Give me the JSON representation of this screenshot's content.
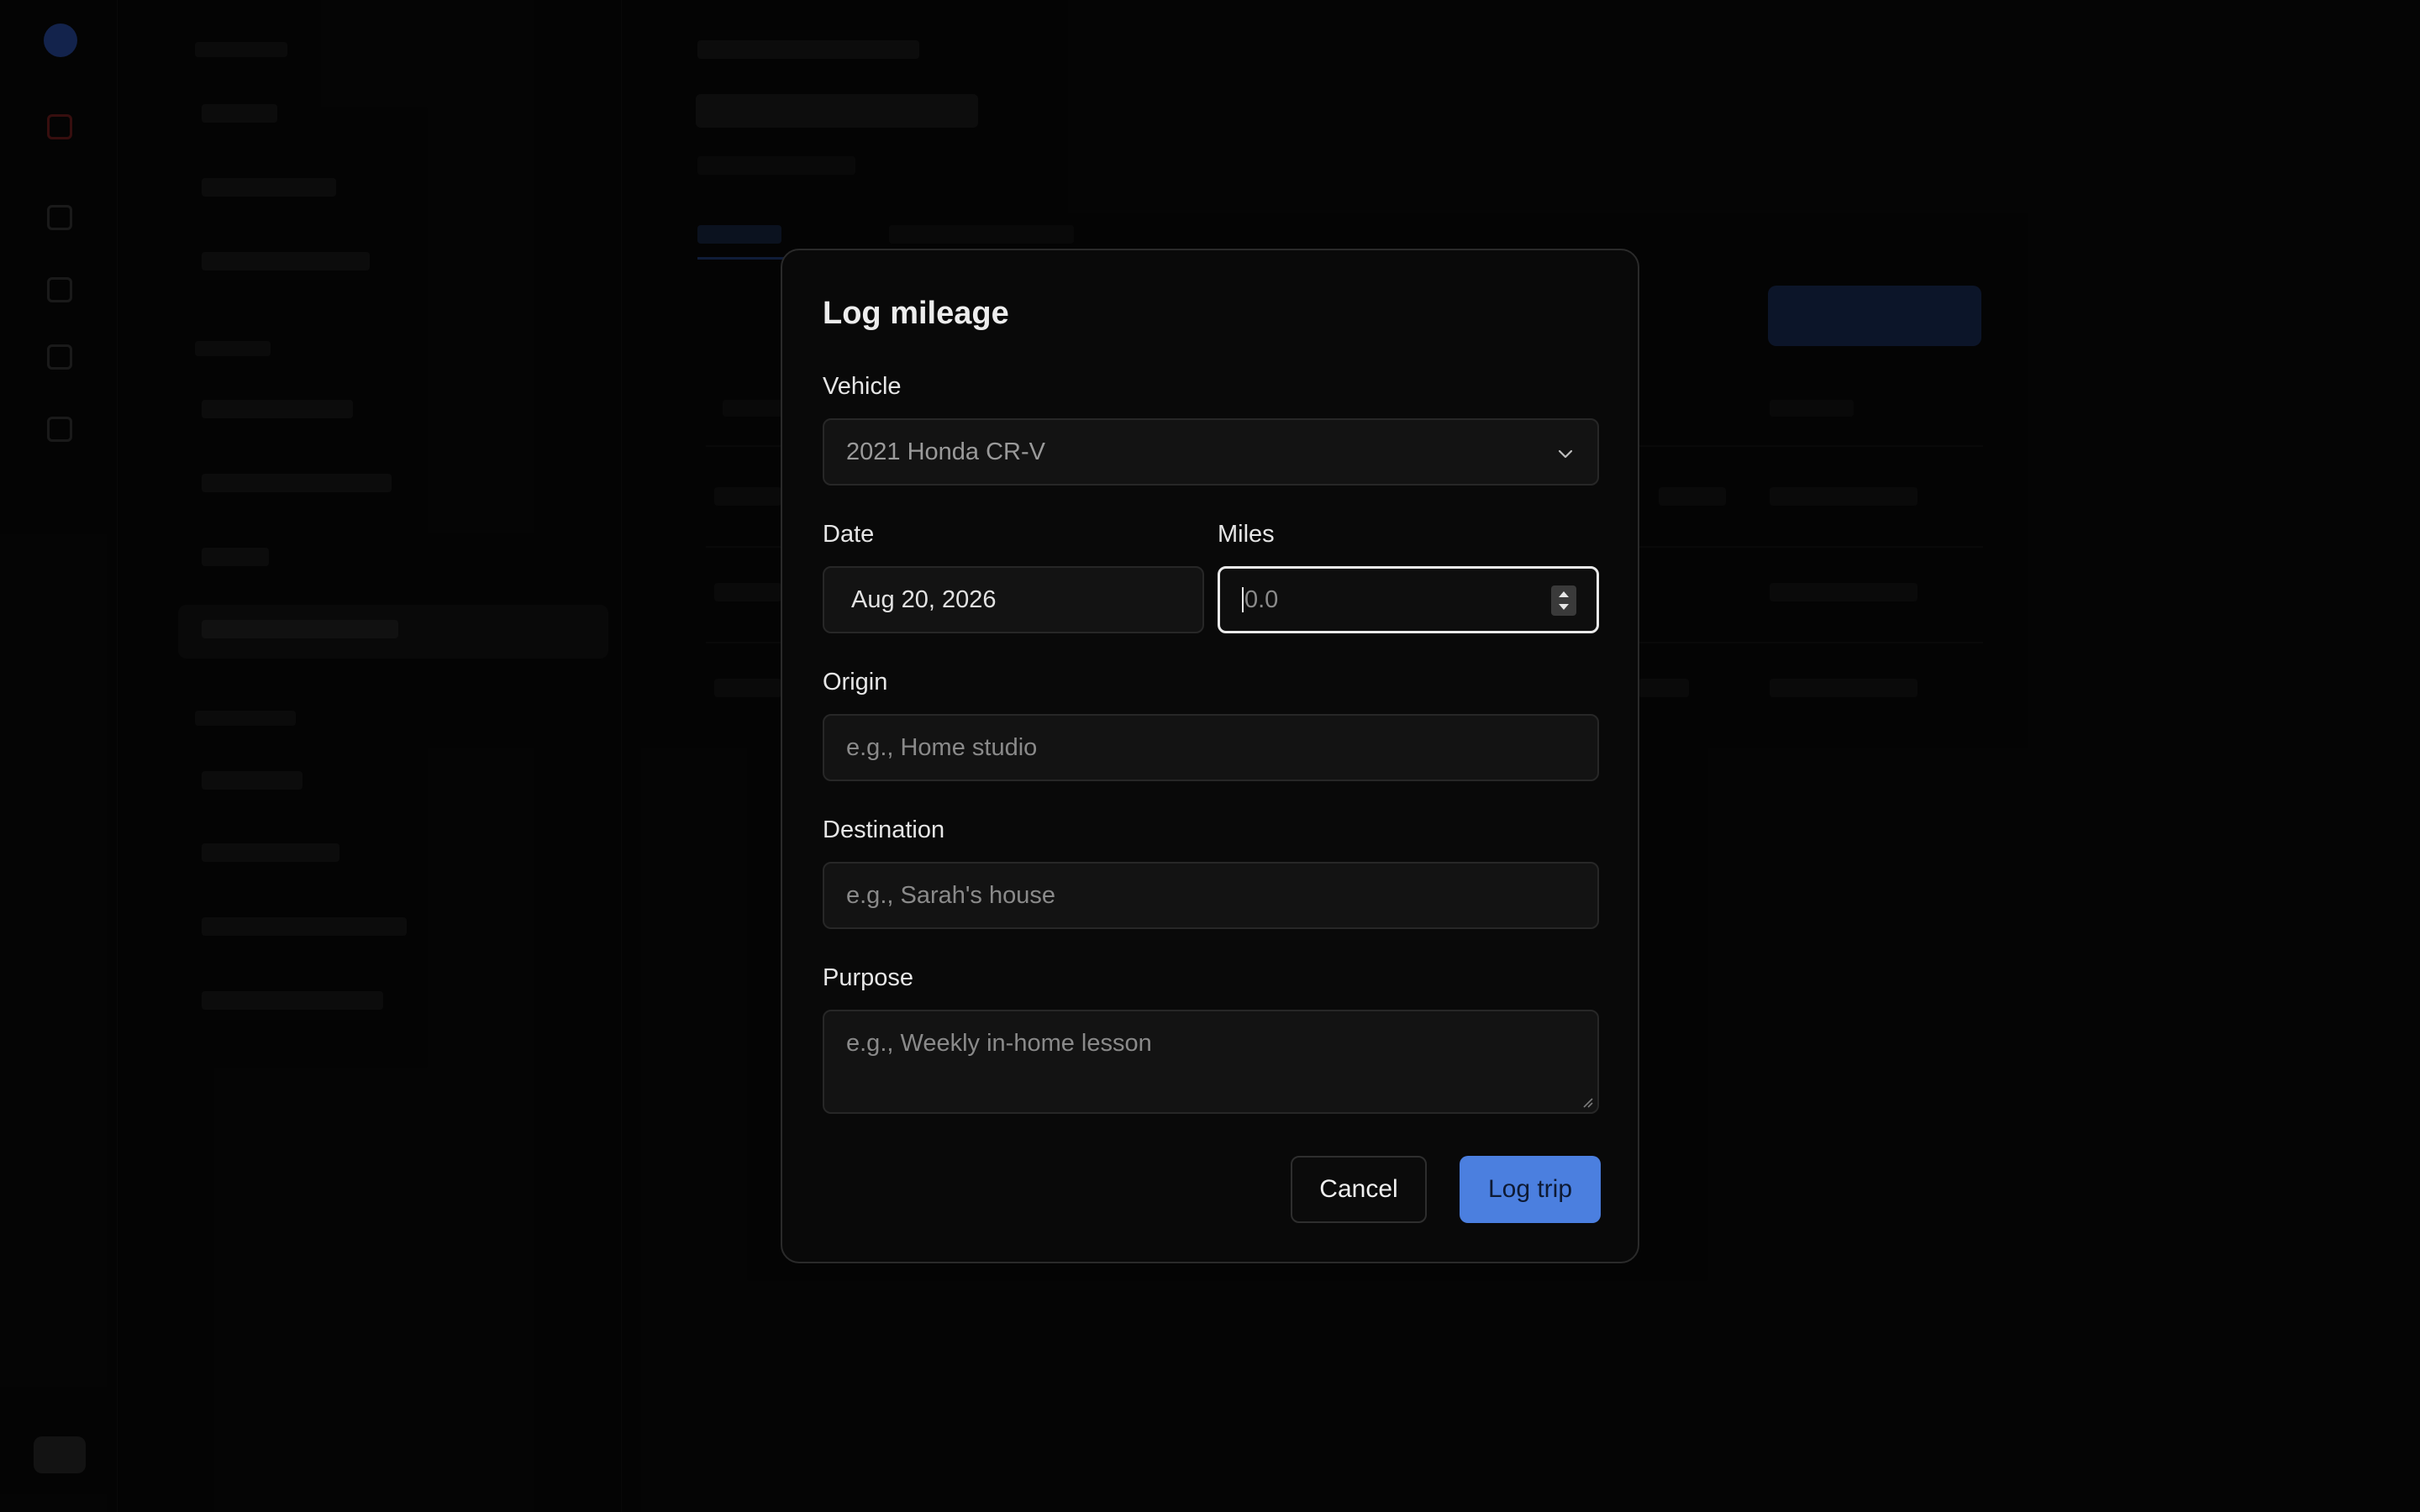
{
  "dialog": {
    "title": "Log mileage",
    "vehicle": {
      "label": "Vehicle",
      "value": "2021 Honda CR-V",
      "icon": "chevron-down-icon"
    },
    "date": {
      "label": "Date",
      "value": "Aug 20, 2026"
    },
    "miles": {
      "label": "Miles",
      "placeholder": "0.0"
    },
    "origin": {
      "label": "Origin",
      "placeholder": "e.g., Home studio"
    },
    "destination": {
      "label": "Destination",
      "placeholder": "e.g., Sarah's house"
    },
    "purpose": {
      "label": "Purpose",
      "placeholder": "e.g., Weekly in-home lesson"
    },
    "cancel_label": "Cancel",
    "submit_label": "Log trip"
  },
  "colors": {
    "accent": "#4b7fdf",
    "dialog_bg": "#090909",
    "field_bg": "#131313",
    "focus_border": "#e9e9e9"
  }
}
